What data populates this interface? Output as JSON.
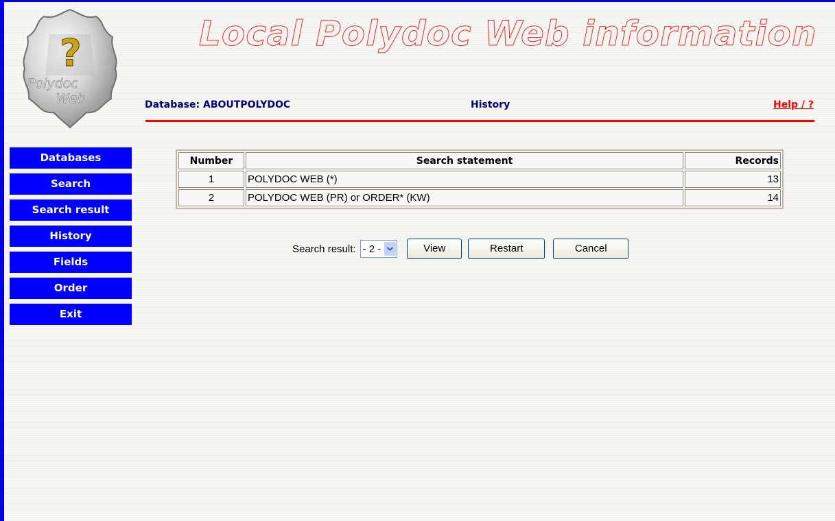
{
  "header": {
    "banner_title": "Local Polydoc Web information",
    "database_label": "Database: ABOUTPOLYDOC",
    "page_title": "History",
    "help_link": "Help / ?"
  },
  "logo": {
    "line1": "Polydoc",
    "line2": "Web",
    "icon": "question-mark-icon"
  },
  "sidebar": {
    "items": [
      {
        "label": "Databases"
      },
      {
        "label": "Search"
      },
      {
        "label": "Search result"
      },
      {
        "label": "History"
      },
      {
        "label": "Fields"
      },
      {
        "label": "Order"
      },
      {
        "label": "Exit"
      }
    ]
  },
  "history": {
    "columns": [
      "Number",
      "Search statement",
      "Records"
    ],
    "rows": [
      {
        "number": "1",
        "statement": "POLYDOC WEB (*)",
        "records": "13"
      },
      {
        "number": "2",
        "statement": "POLYDOC WEB (PR) or ORDER* (KW)",
        "records": "14"
      }
    ]
  },
  "search_form": {
    "label": "Search result:",
    "selected": "- 2 -",
    "view_button": "View",
    "restart_button": "Restart",
    "cancel_button": "Cancel"
  },
  "colors": {
    "nav_bg": "#0000ff",
    "header_text": "#000080",
    "accent_red": "#ff0000",
    "frame_blue": "#0000e0"
  }
}
